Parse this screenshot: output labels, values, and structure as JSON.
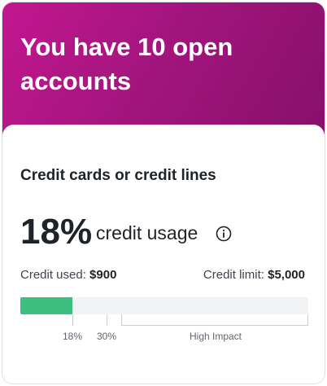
{
  "header": {
    "title": "You have 10 open accounts"
  },
  "section": {
    "title": "Credit cards or credit lines"
  },
  "usage": {
    "percent_text": "18%",
    "label": "credit usage",
    "percent_value": 18,
    "info_icon": "info-icon"
  },
  "credit": {
    "used_label": "Credit used:",
    "used_value": "$900",
    "limit_label": "Credit limit:",
    "limit_value": "$5,000"
  },
  "scale": {
    "tick_18": "18%",
    "tick_30": "30%",
    "high_impact": "High Impact"
  },
  "colors": {
    "header_gradient_start": "#c2178f",
    "header_gradient_end": "#86106a",
    "bar_fill": "#3dc07f",
    "bar_track": "#f1f3f4"
  }
}
